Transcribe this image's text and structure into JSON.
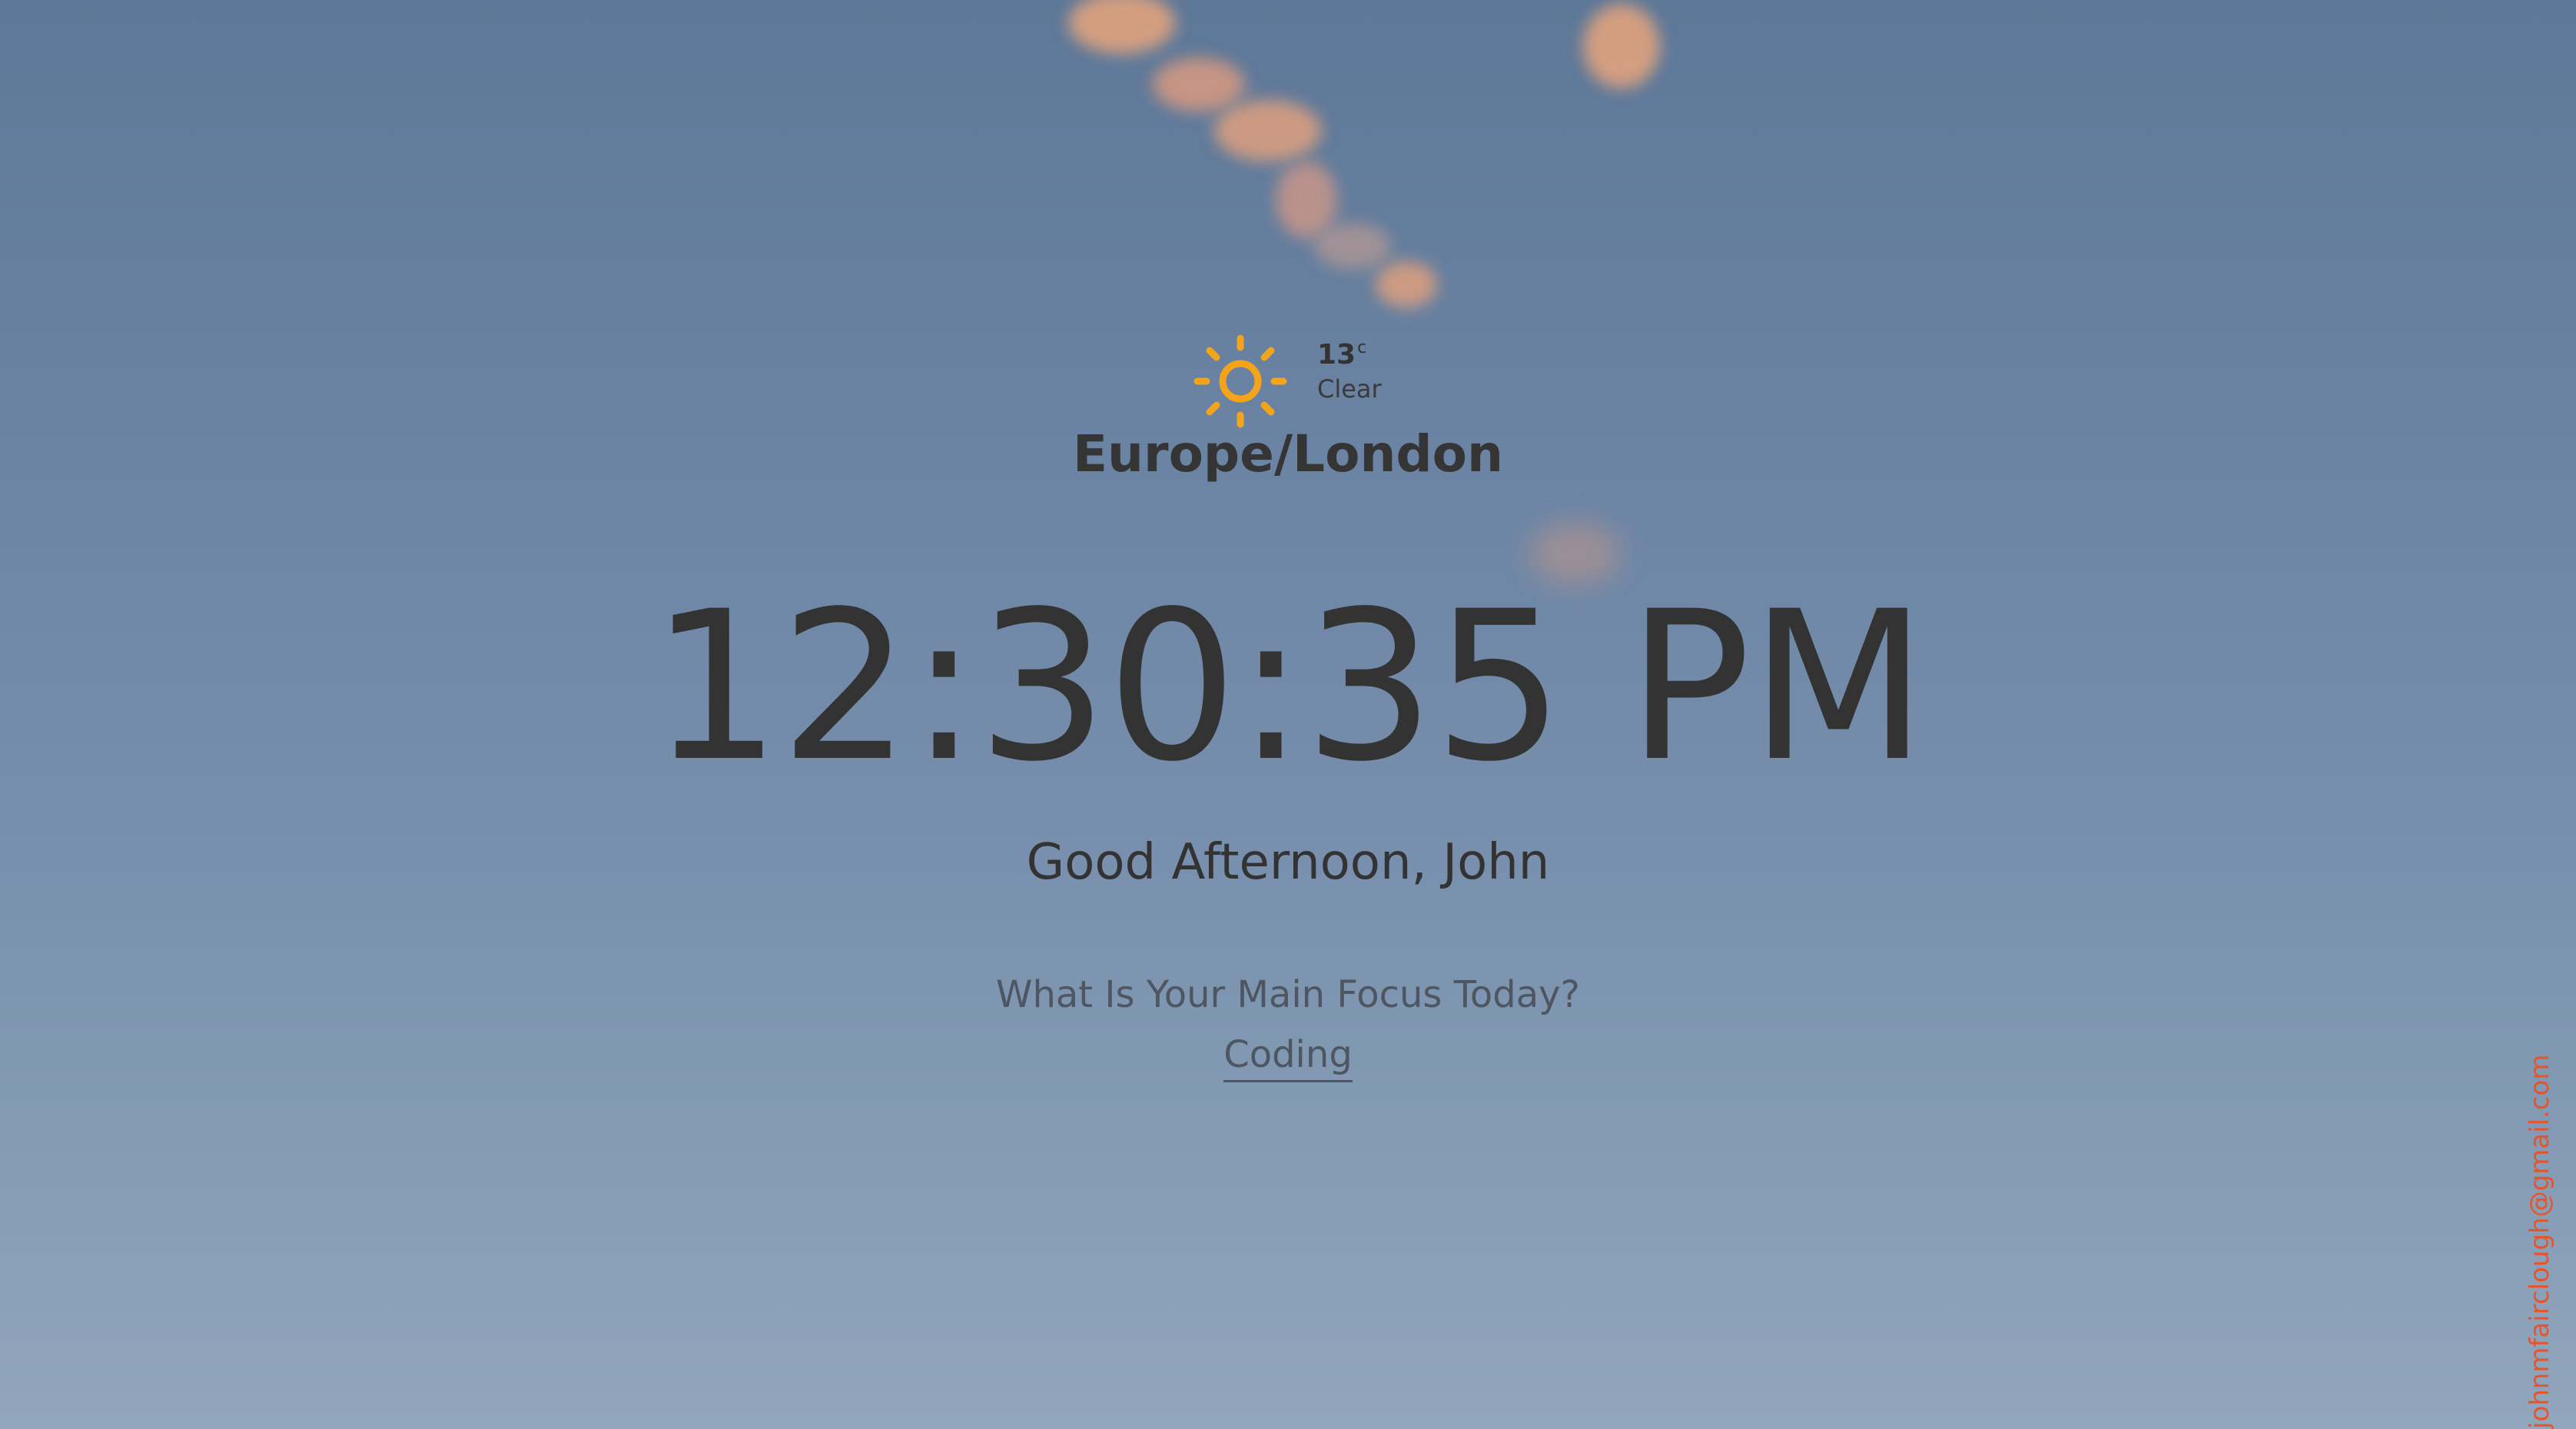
{
  "weather": {
    "icon": "sun-icon",
    "temperature": "13",
    "unit": "c",
    "condition": "Clear"
  },
  "timezone": "Europe/London",
  "clock": {
    "time": "12:30:35 PM"
  },
  "greeting": "Good Afternoon, John",
  "focus": {
    "question": "What Is Your Main Focus Today?",
    "value": "Coding"
  },
  "contact": {
    "email": "johnmfairclough@gmail.com"
  },
  "colors": {
    "sun": "#f4a41a",
    "text": "#333333",
    "email": "#e8542a",
    "sky_top": "#5d7898",
    "sky_bottom": "#91a6bc",
    "cloud": "#e6a07a"
  }
}
